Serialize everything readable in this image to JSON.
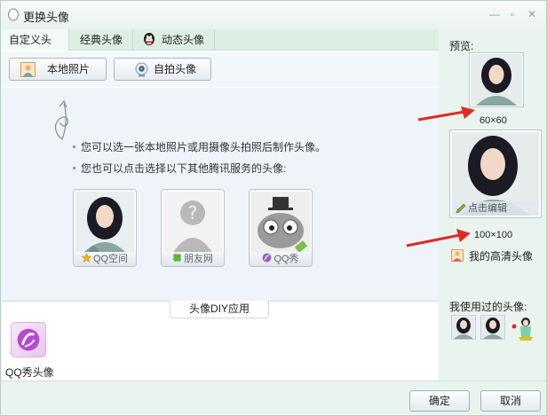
{
  "window": {
    "title": "更换头像",
    "minimize_label": "—",
    "restore_label": "▫",
    "close_label": "✕"
  },
  "tabs": [
    {
      "label": "自定义头像"
    },
    {
      "label": "经典头像"
    },
    {
      "label": "动态头像"
    }
  ],
  "toolbar": {
    "local_photo_label": "本地照片",
    "selfie_label": "自拍头像"
  },
  "content": {
    "line1": "您可以选一张本地照片或用摄像头拍照后制作头像。",
    "line2": "您也可以点击选择以下其他腾讯服务的头像:",
    "services": [
      {
        "label": "QQ空间",
        "icon": "star-icon"
      },
      {
        "label": "朋友网",
        "icon": "clover-icon"
      },
      {
        "label": "QQ秀",
        "icon": "qqshow-small-icon"
      }
    ],
    "diy_tab_label": "头像DIY应用",
    "qqshow_app_label": "QQ秀头像"
  },
  "preview": {
    "label": "预览:",
    "size_small": "60×60",
    "size_large": "100×100",
    "edit_label": "点击编辑",
    "hd_label": "我的高清头像",
    "used_label": "我使用过的头像:"
  },
  "footer": {
    "ok_label": "确定",
    "cancel_label": "取消"
  },
  "colors": {
    "accent_green": "#eaf4ee",
    "arrow_red": "#e02a24"
  }
}
